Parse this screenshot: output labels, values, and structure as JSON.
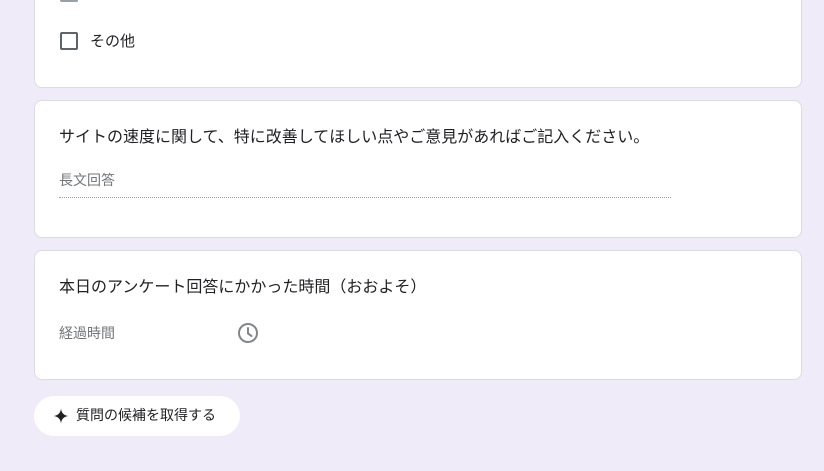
{
  "options_card": {
    "other_option_label": "その他"
  },
  "speed_question": {
    "title": "サイトの速度に関して、特に改善してほしい点やご意見があればご記入ください。",
    "answer_placeholder": "長文回答"
  },
  "time_question": {
    "title": "本日のアンケート回答にかかった時間（おおよそ）",
    "answer_placeholder": "経過時間",
    "icon": "clock-icon"
  },
  "suggest_button": {
    "label": "質問の候補を取得する",
    "icon": "sparkle-icon"
  },
  "colors": {
    "page_background": "#f0ebf8",
    "card_background": "#ffffff",
    "card_border": "#dadce0",
    "placeholder_text": "#70757a"
  }
}
